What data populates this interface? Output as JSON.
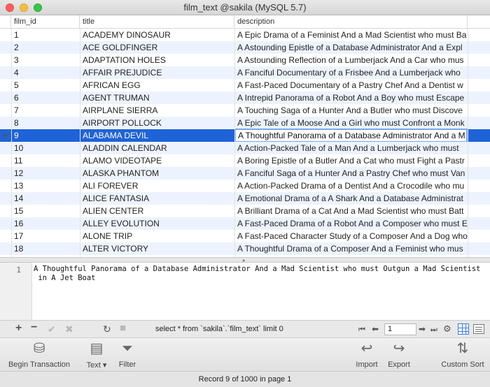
{
  "window": {
    "title": "film_text @sakila (MySQL 5.7)"
  },
  "grid": {
    "columns": [
      "film_id",
      "title",
      "description"
    ],
    "selected_row": 8,
    "rows": [
      {
        "id": "1",
        "title": "ACADEMY DINOSAUR",
        "description": "A Epic Drama of a Feminist And a Mad Scientist who must Ba"
      },
      {
        "id": "2",
        "title": "ACE GOLDFINGER",
        "description": "A Astounding Epistle of a Database Administrator And a Expl"
      },
      {
        "id": "3",
        "title": "ADAPTATION HOLES",
        "description": "A Astounding Reflection of a Lumberjack And a Car who mus"
      },
      {
        "id": "4",
        "title": "AFFAIR PREJUDICE",
        "description": "A Fanciful Documentary of a Frisbee And a Lumberjack who"
      },
      {
        "id": "5",
        "title": "AFRICAN EGG",
        "description": "A Fast-Paced Documentary of a Pastry Chef And a Dentist w"
      },
      {
        "id": "6",
        "title": "AGENT TRUMAN",
        "description": "A Intrepid Panorama of a Robot And a Boy who must Escape"
      },
      {
        "id": "7",
        "title": "AIRPLANE SIERRA",
        "description": "A Touching Saga of a Hunter And a Butler who must Discove"
      },
      {
        "id": "8",
        "title": "AIRPORT POLLOCK",
        "description": "A Epic Tale of a Moose And a Girl who must Confront a Monk"
      },
      {
        "id": "9",
        "title": "ALABAMA DEVIL",
        "description": "A Thoughtful Panorama of a Database Administrator And a M"
      },
      {
        "id": "10",
        "title": "ALADDIN CALENDAR",
        "description": "A Action-Packed Tale of a Man And a Lumberjack who must"
      },
      {
        "id": "11",
        "title": "ALAMO VIDEOTAPE",
        "description": "A Boring Epistle of a Butler And a Cat who must Fight a Pastr"
      },
      {
        "id": "12",
        "title": "ALASKA PHANTOM",
        "description": "A Fanciful Saga of a Hunter And a Pastry Chef who must Van"
      },
      {
        "id": "13",
        "title": "ALI FOREVER",
        "description": "A Action-Packed Drama of a Dentist And a Crocodile who mu"
      },
      {
        "id": "14",
        "title": "ALICE FANTASIA",
        "description": "A Emotional Drama of a A Shark And a Database Administrat"
      },
      {
        "id": "15",
        "title": "ALIEN CENTER",
        "description": "A Brilliant Drama of a Cat And a Mad Scientist who must Batt"
      },
      {
        "id": "16",
        "title": "ALLEY EVOLUTION",
        "description": "A Fast-Paced Drama of a Robot And a Composer who must E"
      },
      {
        "id": "17",
        "title": "ALONE TRIP",
        "description": "A Fast-Paced Character Study of a Composer And a Dog who"
      },
      {
        "id": "18",
        "title": "ALTER VICTORY",
        "description": "A Thoughtful Drama of a Composer And a Feminist who mus"
      }
    ]
  },
  "editor": {
    "line_number": "1",
    "text": "A Thoughtful Panorama of a Database Administrator And a Mad Scientist who must Outgun a Mad Scientist\n in A Jet Boat"
  },
  "sqlbar": {
    "query": "select * from `sakila`.`film_text` limit 0",
    "page": "1"
  },
  "toolbar": {
    "begin_transaction": "Begin Transaction",
    "text": "Text",
    "filter": "Filter",
    "import": "Import",
    "export": "Export",
    "custom_sort": "Custom Sort"
  },
  "footer": {
    "status": "Record 9 of 1000 in page 1"
  },
  "colors": {
    "selection": "#1f63d8",
    "alt_row": "#edf3fe",
    "accent": "#3b7ddd"
  }
}
